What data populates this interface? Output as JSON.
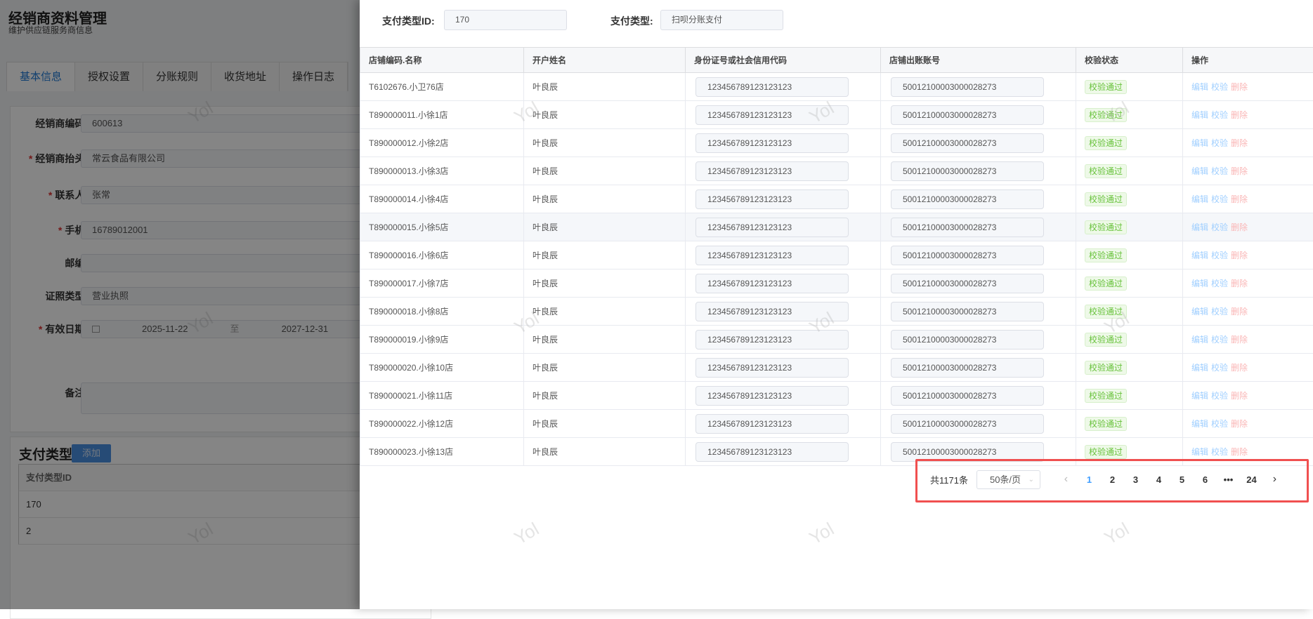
{
  "page": {
    "title": "经销商资料管理",
    "subtitle": "维护供应链服务商信息",
    "tabs": [
      "基本信息",
      "授权设置",
      "分账规则",
      "收货地址",
      "操作日志"
    ],
    "form": {
      "code_label": "经销商编码:",
      "code_value": "600613",
      "header_label": "经销商抬头:",
      "header_value": "常云食品有限公司",
      "contact_label": "联系人:",
      "contact_value": "张常",
      "phone_label": "手机:",
      "phone_value": "16789012001",
      "zip_label": "邮编:",
      "zip_value": "",
      "cert_label": "证照类型:",
      "cert_value": "营业执照",
      "date_label": "有效日期:",
      "date_start": "2025-11-22",
      "date_sep": "至",
      "date_end": "2027-12-31",
      "remark_label": "备注:"
    },
    "payment": {
      "title": "支付类型",
      "add_label": "添加",
      "header": "支付类型ID",
      "rows": [
        "170",
        "2"
      ]
    }
  },
  "drawer": {
    "pay_id_label": "支付类型ID:",
    "pay_id_value": "170",
    "pay_type_label": "支付类型:",
    "pay_type_value": "扫呗分账支付",
    "columns": [
      "店铺编码.名称",
      "开户姓名",
      "身份证号或社会信用代码",
      "店铺出账账号",
      "校验状态",
      "操作"
    ],
    "rows": [
      {
        "store": "T6102676.小卫76店",
        "name": "叶良辰",
        "id": "123456789123123123",
        "account": "50012100003000028273",
        "status": "校验通过"
      },
      {
        "store": "T890000011.小徐1店",
        "name": "叶良辰",
        "id": "123456789123123123",
        "account": "50012100003000028273",
        "status": "校验通过"
      },
      {
        "store": "T890000012.小徐2店",
        "name": "叶良辰",
        "id": "123456789123123123",
        "account": "50012100003000028273",
        "status": "校验通过"
      },
      {
        "store": "T890000013.小徐3店",
        "name": "叶良辰",
        "id": "123456789123123123",
        "account": "50012100003000028273",
        "status": "校验通过"
      },
      {
        "store": "T890000014.小徐4店",
        "name": "叶良辰",
        "id": "123456789123123123",
        "account": "50012100003000028273",
        "status": "校验通过"
      },
      {
        "store": "T890000015.小徐5店",
        "name": "叶良辰",
        "id": "123456789123123123",
        "account": "50012100003000028273",
        "status": "校验通过"
      },
      {
        "store": "T890000016.小徐6店",
        "name": "叶良辰",
        "id": "123456789123123123",
        "account": "50012100003000028273",
        "status": "校验通过"
      },
      {
        "store": "T890000017.小徐7店",
        "name": "叶良辰",
        "id": "123456789123123123",
        "account": "50012100003000028273",
        "status": "校验通过"
      },
      {
        "store": "T890000018.小徐8店",
        "name": "叶良辰",
        "id": "123456789123123123",
        "account": "50012100003000028273",
        "status": "校验通过"
      },
      {
        "store": "T890000019.小徐9店",
        "name": "叶良辰",
        "id": "123456789123123123",
        "account": "50012100003000028273",
        "status": "校验通过"
      },
      {
        "store": "T890000020.小徐10店",
        "name": "叶良辰",
        "id": "123456789123123123",
        "account": "50012100003000028273",
        "status": "校验通过"
      },
      {
        "store": "T890000021.小徐11店",
        "name": "叶良辰",
        "id": "123456789123123123",
        "account": "50012100003000028273",
        "status": "校验通过"
      },
      {
        "store": "T890000022.小徐12店",
        "name": "叶良辰",
        "id": "123456789123123123",
        "account": "50012100003000028273",
        "status": "校验通过"
      },
      {
        "store": "T890000023.小徐13店",
        "name": "叶良辰",
        "id": "123456789123123123",
        "account": "50012100003000028273",
        "status": "校验通过"
      }
    ],
    "actions": {
      "edit": "编辑",
      "verify": "校验",
      "delete": "删除"
    },
    "pagination": {
      "total": "共1171条",
      "page_size": "50条/页",
      "pages": [
        "1",
        "2",
        "3",
        "4",
        "5",
        "6",
        "•••",
        "24"
      ],
      "current": "1"
    }
  },
  "watermark": "Yol",
  "colors": {
    "accent": "#409eff",
    "success": "#67c23a",
    "danger": "#f56c6c",
    "highlight": "#f05050"
  }
}
